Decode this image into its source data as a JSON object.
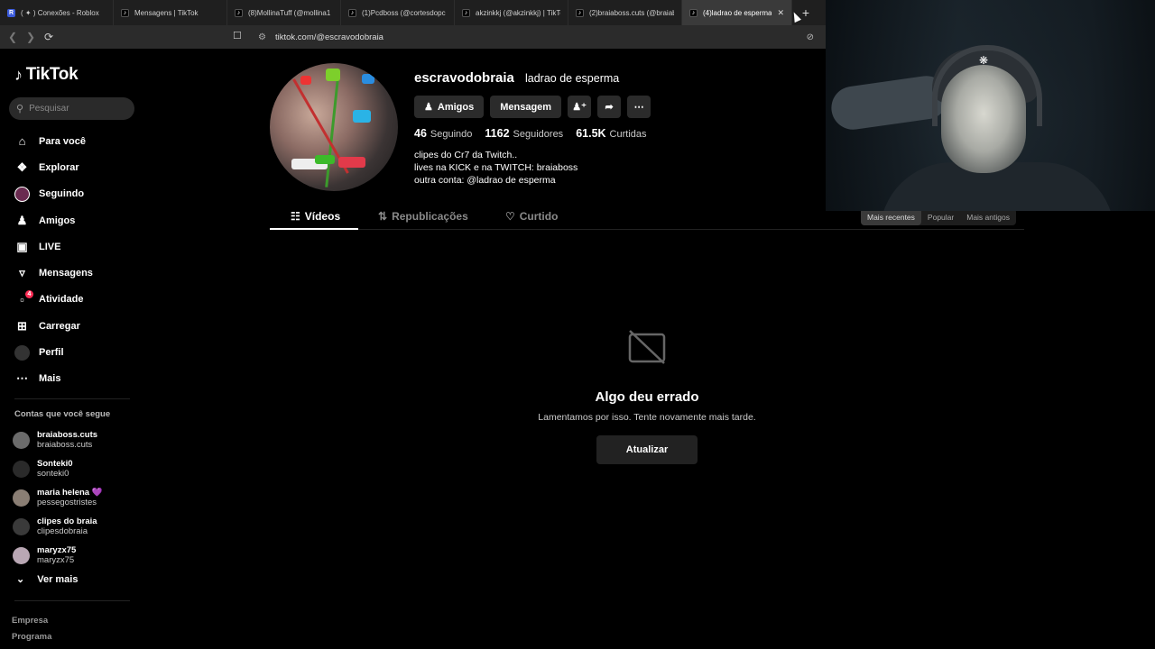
{
  "browser": {
    "tabs": [
      {
        "title": "( ✦ ) Conexões - Roblox",
        "icon": "roblox"
      },
      {
        "title": "Mensagens | TikTok",
        "icon": "tiktok"
      },
      {
        "title": "(8)MollinaTuff (@mollina1",
        "icon": "tiktok"
      },
      {
        "title": "(1)Pcdboss (@cortesdopc",
        "icon": "tiktok"
      },
      {
        "title": "akzinkkj (@akzinkkj) | TikTo",
        "icon": "tiktok"
      },
      {
        "title": "(2)braiaboss.cuts (@braiab",
        "icon": "tiktok"
      },
      {
        "title": "(4)ladrao de esperma",
        "icon": "tiktok",
        "active": true
      }
    ],
    "new_tab": "+",
    "url": "tiktok.com/@escravodobraia"
  },
  "sidebar": {
    "brand": "TikTok",
    "search_placeholder": "Pesquisar",
    "nav": [
      {
        "label": "Para você",
        "icon": "home-icon"
      },
      {
        "label": "Explorar",
        "icon": "compass-icon"
      },
      {
        "label": "Seguindo",
        "icon": "following-avatar-icon"
      },
      {
        "label": "Amigos",
        "icon": "friends-icon"
      },
      {
        "label": "LIVE",
        "icon": "live-icon"
      },
      {
        "label": "Mensagens",
        "icon": "messages-icon"
      },
      {
        "label": "Atividade",
        "icon": "activity-icon",
        "badge": "4"
      },
      {
        "label": "Carregar",
        "icon": "upload-icon"
      },
      {
        "label": "Perfil",
        "icon": "profile-avatar-icon"
      },
      {
        "label": "Mais",
        "icon": "more-icon"
      }
    ],
    "following_title": "Contas que você segue",
    "following": [
      {
        "name": "braiaboss.cuts",
        "username": "braiaboss.cuts"
      },
      {
        "name": "Sonteki0",
        "username": "sonteki0"
      },
      {
        "name": "maria helena 💜",
        "username": "pessegostristes"
      },
      {
        "name": "clipes do braia",
        "username": "clipesdobraia"
      },
      {
        "name": "maryzx75",
        "username": "maryzx75"
      }
    ],
    "see_more": "Ver mais",
    "footer": [
      "Empresa",
      "Programa"
    ]
  },
  "profile": {
    "username": "escravodobraia",
    "nickname": "ladrao de esperma",
    "buttons": {
      "friends": "Amigos",
      "message": "Mensagem"
    },
    "stats": {
      "following_count": "46",
      "following_label": "Seguindo",
      "followers_count": "1162",
      "followers_label": "Seguidores",
      "likes_count": "61.5K",
      "likes_label": "Curtidas"
    },
    "bio": [
      "clipes do Cr7 da Twitch..",
      "lives na KICK e na TWITCH: braiaboss",
      "outra conta: @ladrao de esperma"
    ],
    "tabs": {
      "videos": "Vídeos",
      "reposts": "Republicações",
      "liked": "Curtido"
    },
    "sort": {
      "recent": "Mais recentes",
      "popular": "Popular",
      "oldest": "Mais antigos"
    }
  },
  "error": {
    "title": "Algo deu errado",
    "message": "Lamentamos por isso. Tente novamente mais tarde.",
    "retry": "Atualizar"
  },
  "colors": {
    "accent": "#fe2c55",
    "background": "#000000",
    "button": "#2b2b2b"
  }
}
